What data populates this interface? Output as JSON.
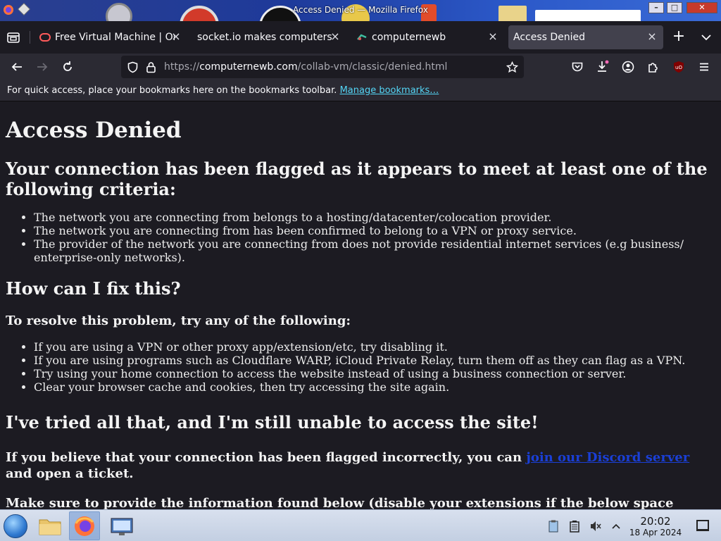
{
  "window": {
    "title": "Access Denied — Mozilla Firefox"
  },
  "tabs": [
    {
      "label": "Free Virtual Machine | Or",
      "icon": "collabvm-icon",
      "active": false
    },
    {
      "label": "socket.io makes computers",
      "icon": "none",
      "active": false
    },
    {
      "label": "computernewb",
      "icon": "computernewb-icon",
      "active": false
    },
    {
      "label": "Access Denied",
      "icon": "none",
      "active": true
    }
  ],
  "urlbar": {
    "scheme": "https://",
    "host": "computernewb.com",
    "path": "/collab-vm/classic/denied.html"
  },
  "bookmarks_bar": {
    "text": "For quick access, place your bookmarks here on the bookmarks toolbar.",
    "link": "Manage bookmarks…"
  },
  "page": {
    "h1": "Access Denied",
    "criteria_heading": "Your connection has been flagged as it appears to meet at least one of the following criteria:",
    "criteria": [
      "The network you are connecting from belongs to a hosting/datacenter/colocation provider.",
      "The network you are connecting from has been confirmed to belong to a VPN or proxy service.",
      "The provider of the network you are connecting from does not provide residential internet services (e.g business/ enterprise-only networks)."
    ],
    "fix_heading": "How can I fix this?",
    "resolve_heading": "To resolve this problem, try any of the following:",
    "fixes": [
      "If you are using a VPN or other proxy app/extension/etc, try disabling it.",
      "If you are using programs such as Cloudflare WARP, iCloud Private Relay, turn them off as they can flag as a VPN.",
      "Try using your home connection to access the website instead of using a business connection or server.",
      "Clear your browser cache and cookies, then try accessing the site again."
    ],
    "tried_heading": "I've tried all that, and I'm still unable to access the site!",
    "believe_pre": "If you believe that your connection has been flagged incorrectly, you can ",
    "believe_link": "join our Discord server",
    "believe_post": " and open a ticket.",
    "provide_text": "Make sure to provide the information found below (disable your extensions if the below space"
  },
  "taskbar": {
    "time": "20:02",
    "date": "18 Apr 2024"
  },
  "colors": {
    "toolbar": "#2b2a33",
    "content_bg": "#1c1b22",
    "link_blue": "#1a3fd6",
    "bookmark_link": "#54d6f6"
  }
}
